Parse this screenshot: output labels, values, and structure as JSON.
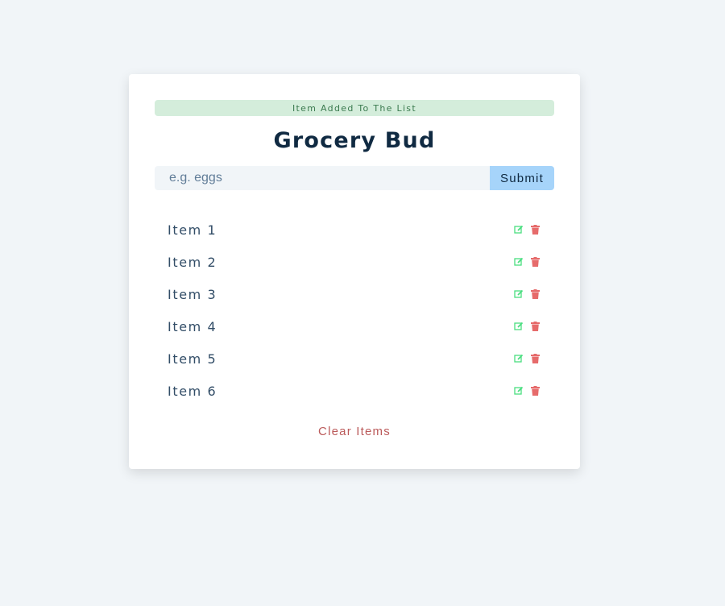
{
  "alert": {
    "text": "Item Added To The List",
    "color": "#d4eddb"
  },
  "header": {
    "title": "Grocery Bud"
  },
  "form": {
    "placeholder": "e.g. eggs",
    "value": "",
    "submit_label": "Submit"
  },
  "items": [
    {
      "label": "Item 1",
      "edit_icon": "edit-icon",
      "delete_icon": "trash-icon"
    },
    {
      "label": "Item 2",
      "edit_icon": "edit-icon",
      "delete_icon": "trash-icon"
    },
    {
      "label": "Item 3",
      "edit_icon": "edit-icon",
      "delete_icon": "trash-icon"
    },
    {
      "label": "Item 4",
      "edit_icon": "edit-icon",
      "delete_icon": "trash-icon"
    },
    {
      "label": "Item 5",
      "edit_icon": "edit-icon",
      "delete_icon": "trash-icon"
    },
    {
      "label": "Item 6",
      "edit_icon": "edit-icon",
      "delete_icon": "trash-icon"
    }
  ],
  "footer": {
    "clear_label": "Clear Items"
  },
  "colors": {
    "edit": "#4ade80",
    "delete": "#e66b6b",
    "submit": "#a6d4fa",
    "title": "#102a42"
  }
}
